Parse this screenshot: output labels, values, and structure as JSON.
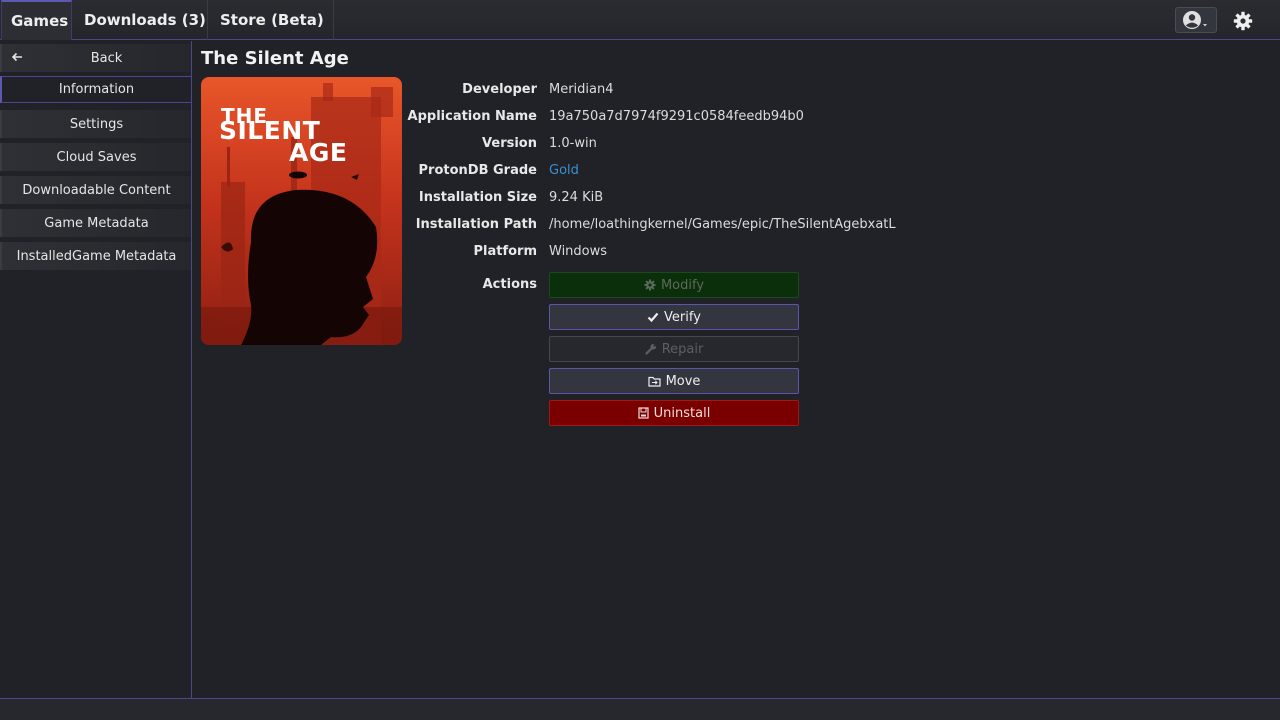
{
  "tabs": [
    {
      "label": "Games",
      "active": true
    },
    {
      "label": "Downloads (3)",
      "active": false
    },
    {
      "label": "Store (Beta)",
      "active": false
    }
  ],
  "topbar_icons": {
    "account": "account-circle-icon",
    "settings": "gear-icon"
  },
  "sidebar": {
    "back_label": "Back",
    "items": [
      {
        "label": "Information",
        "active": true
      },
      {
        "label": "Settings",
        "active": false
      },
      {
        "label": "Cloud Saves",
        "active": false
      },
      {
        "label": "Downloadable Content",
        "active": false
      },
      {
        "label": "Game Metadata",
        "active": false
      },
      {
        "label": "InstalledGame Metadata",
        "active": false
      }
    ]
  },
  "game": {
    "title": "The Silent Age",
    "cover_text": [
      "THE",
      "SILENT",
      "AGE"
    ],
    "details": [
      {
        "label": "Developer",
        "value": "Meridian4"
      },
      {
        "label": "Application Name",
        "value": "19a750a7d7974f9291c0584feedb94b0"
      },
      {
        "label": "Version",
        "value": "1.0-win"
      },
      {
        "label": "ProtonDB Grade",
        "value": "Gold"
      },
      {
        "label": "Installation Size",
        "value": "9.24 KiB"
      },
      {
        "label": "Installation Path",
        "value": "/home/loathingkernel/Games/epic/TheSilentAgebxatL"
      },
      {
        "label": "Platform",
        "value": "Windows"
      }
    ],
    "actions_label": "Actions",
    "actions": [
      {
        "label": "Modify",
        "icon": "gear-icon",
        "enabled": false
      },
      {
        "label": "Verify",
        "icon": "check-icon",
        "enabled": true
      },
      {
        "label": "Repair",
        "icon": "wrench-icon",
        "enabled": false
      },
      {
        "label": "Move",
        "icon": "folder-icon",
        "enabled": true
      },
      {
        "label": "Uninstall",
        "icon": "trash-icon",
        "enabled": true
      }
    ]
  },
  "colors": {
    "accent": "#5c58b3",
    "link": "#3d8fd1",
    "danger": "#7a0000",
    "modify_bg": "#0b2e0b"
  }
}
